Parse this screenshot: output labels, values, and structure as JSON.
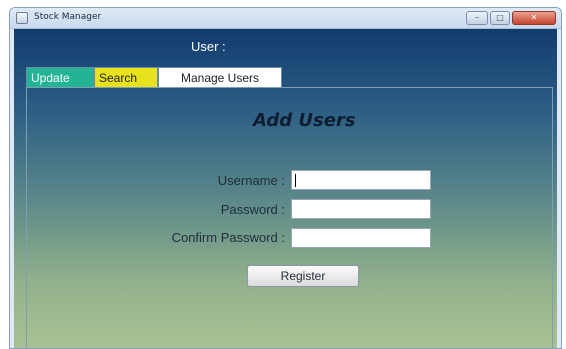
{
  "window": {
    "title": "Stock Manager",
    "min_label": "–",
    "max_label": "□",
    "close_label": "✕"
  },
  "header": {
    "user_label": "User :"
  },
  "tabs": [
    {
      "label": "Update",
      "color": "#23b495"
    },
    {
      "label": "Search",
      "color": "#e7e21d"
    },
    {
      "label": "Manage Users",
      "color": "#ffffff",
      "selected": true
    }
  ],
  "form": {
    "title": "Add Users",
    "username_label": "Username :",
    "password_label": "Password :",
    "confirm_label": "Confirm Password :",
    "username_value": "",
    "password_value": "",
    "confirm_value": "",
    "register_label": "Register"
  },
  "colors": {
    "background_top": "#123b6e",
    "background_bottom": "#a9c294",
    "close_button": "#c7442f"
  }
}
